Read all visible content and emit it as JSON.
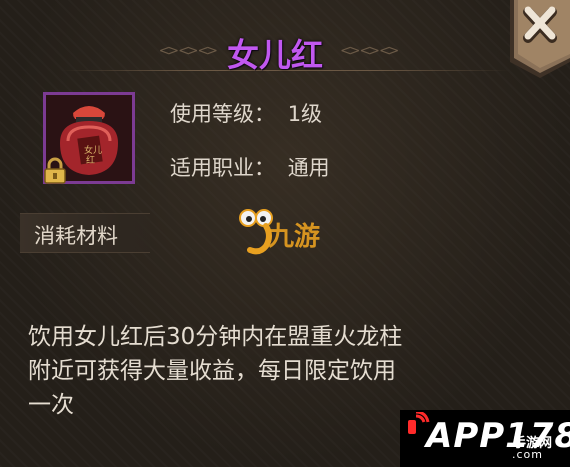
{
  "item": {
    "name": "女儿红",
    "icon": "wine-jar-icon",
    "locked": true,
    "category": "消耗材料",
    "level_label": "使用等级：",
    "level_value": "1级",
    "class_label": "适用职业：",
    "class_value": "通用",
    "description_lines": [
      "饮用女儿红后30分钟内在盟重火龙柱",
      "附近可获得大量收益，每日限定饮用",
      "一次"
    ]
  },
  "watermarks": {
    "site": "九游",
    "app_logo": "APP178",
    "app_logo_suffix": "手游网",
    "app_logo_domain": ".com"
  },
  "colors": {
    "title": "#c158f0",
    "icon_border": "#7c3b93",
    "text": "#dfd7cc",
    "close_bg": "#8a7158"
  }
}
